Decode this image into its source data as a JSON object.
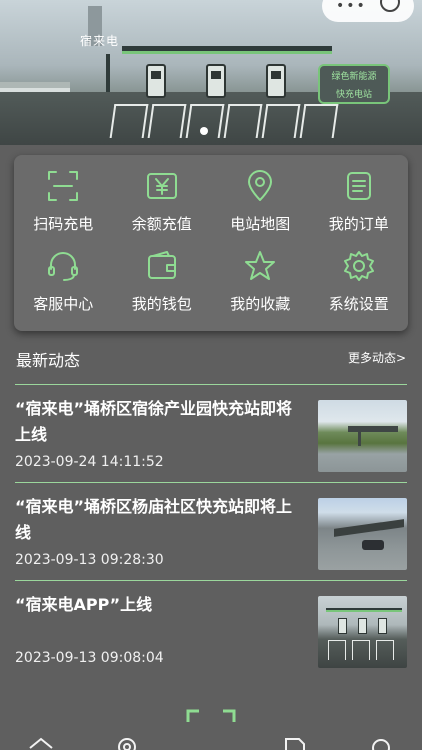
{
  "banner": {
    "brand_text": "宿来电",
    "sign_line1": "绿色新能源",
    "sign_line2": "快充电站"
  },
  "menu": {
    "items": [
      {
        "label": "扫码充电",
        "icon": "scan-icon"
      },
      {
        "label": "余额充值",
        "icon": "yuan-icon"
      },
      {
        "label": "电站地图",
        "icon": "map-pin-icon"
      },
      {
        "label": "我的订单",
        "icon": "order-list-icon"
      },
      {
        "label": "客服中心",
        "icon": "headset-icon"
      },
      {
        "label": "我的钱包",
        "icon": "wallet-icon"
      },
      {
        "label": "我的收藏",
        "icon": "star-icon"
      },
      {
        "label": "系统设置",
        "icon": "gear-icon"
      }
    ]
  },
  "news": {
    "title": "最新动态",
    "more_label": "更多动态>",
    "items": [
      {
        "headline": "“宿来电”埇桥区宿徐产业园快充站即将上线",
        "time": "2023-09-24 14:11:52"
      },
      {
        "headline": "“宿来电”埇桥区杨庙社区快充站即将上线",
        "time": "2023-09-13 09:28:30"
      },
      {
        "headline": "“宿来电APP”上线",
        "time": "2023-09-13 09:08:04"
      }
    ]
  },
  "colors": {
    "accent": "#8fdc92",
    "background": "#5f5f5f",
    "card": "#6b6b6b"
  }
}
